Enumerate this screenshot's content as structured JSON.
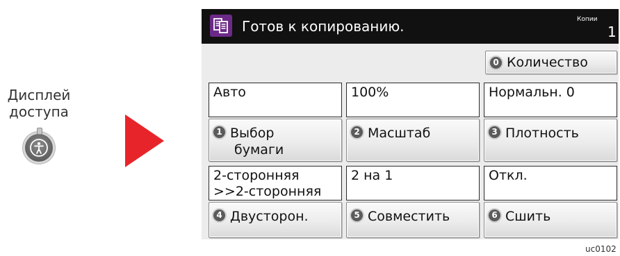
{
  "access_key": {
    "label_line1": "Дисплей",
    "label_line2": "доступа"
  },
  "header": {
    "title": "Готов к копированию.",
    "copies_label": "Копии",
    "copies_value": "1"
  },
  "quantity_button": {
    "number": "0",
    "label": "Количество"
  },
  "settings": [
    {
      "value": "Авто",
      "number": "1",
      "label_line1": "Выбор",
      "label_line2": "бумаги"
    },
    {
      "value": "100%",
      "number": "2",
      "label_line1": "Масштаб",
      "label_line2": ""
    },
    {
      "value": "Нормальн. 0",
      "number": "3",
      "label_line1": "Плотность",
      "label_line2": ""
    },
    {
      "value_line1": "2-сторонняя",
      "value_line2": ">>2-сторонняя",
      "number": "4",
      "label_line1": "Двусторон.",
      "label_line2": ""
    },
    {
      "value": "2 на 1",
      "number": "5",
      "label_line1": "Совместить",
      "label_line2": ""
    },
    {
      "value": "Откл.",
      "number": "6",
      "label_line1": "Сшить",
      "label_line2": ""
    }
  ],
  "figure_code": "uc0102",
  "colors": {
    "header_bg": "#111111",
    "copy_icon_bg": "#6c2a88",
    "arrow": "#e8242b",
    "screen_bg": "#ececec"
  },
  "icons": {
    "accessibility_key": "accessibility-person-icon",
    "copy_mode": "copy-documents-icon",
    "pointer": "right-arrow-icon"
  }
}
